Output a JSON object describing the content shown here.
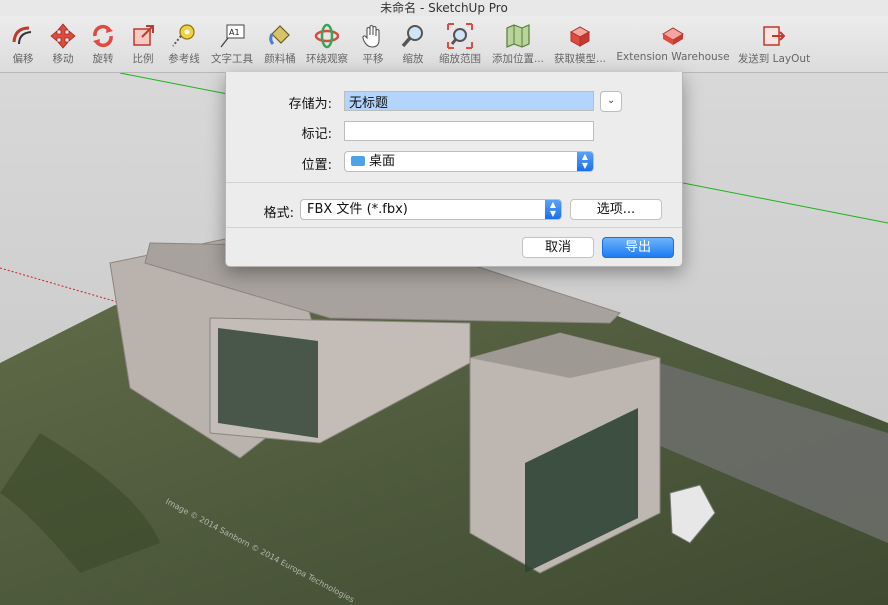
{
  "window": {
    "title": "未命名 - SketchUp Pro"
  },
  "toolbar": {
    "items": [
      {
        "label": "偏移",
        "icon": "offset-icon"
      },
      {
        "label": "移动",
        "icon": "move-icon"
      },
      {
        "label": "旋转",
        "icon": "rotate-icon"
      },
      {
        "label": "比例",
        "icon": "scale-icon"
      },
      {
        "label": "参考线",
        "icon": "tape-measure-icon"
      },
      {
        "label": "文字工具",
        "icon": "text-tool-icon"
      },
      {
        "label": "颜料桶",
        "icon": "paint-bucket-icon"
      },
      {
        "label": "环绕观察",
        "icon": "orbit-icon"
      },
      {
        "label": "平移",
        "icon": "pan-icon"
      },
      {
        "label": "缩放",
        "icon": "zoom-icon"
      },
      {
        "label": "缩放范围",
        "icon": "zoom-extents-icon"
      },
      {
        "label": "添加位置...",
        "icon": "add-location-icon"
      },
      {
        "label": "获取模型...",
        "icon": "get-models-icon"
      },
      {
        "label": "Extension Warehouse",
        "icon": "extension-warehouse-icon"
      },
      {
        "label": "发送到 LayOut",
        "icon": "send-to-layout-icon"
      }
    ]
  },
  "dialog": {
    "save_as_label": "存储为:",
    "save_as_value": "无标题",
    "tags_label": "标记:",
    "tags_value": "",
    "where_label": "位置:",
    "where_value": "桌面",
    "format_label": "格式:",
    "format_value": "FBX 文件 (*.fbx)",
    "options_label": "选项...",
    "cancel_label": "取消",
    "export_label": "导出"
  },
  "viewport": {
    "watermark": "Image © 2014 Sanborn  © 2014 Europa Technologies"
  },
  "colors": {
    "accent": "#1f7cf3",
    "axis_green": "#19b419",
    "axis_red": "#cc2222",
    "axis_blue": "#2222cc"
  }
}
